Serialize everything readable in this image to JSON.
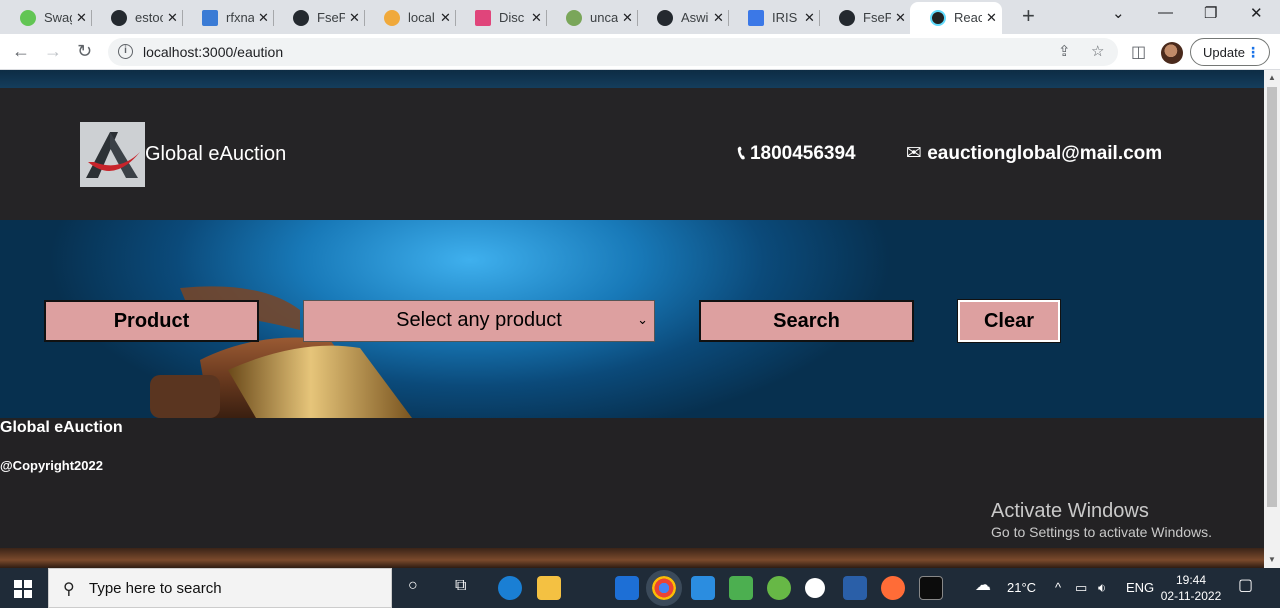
{
  "browser": {
    "tabs": [
      {
        "title": "Swag",
        "color": "#62c554"
      },
      {
        "title": "estoc",
        "color": "#24292f"
      },
      {
        "title": "rfxna",
        "color": "#3a7bd5"
      },
      {
        "title": "FseP",
        "color": "#24292f"
      },
      {
        "title": "local",
        "color": "#f0a93b"
      },
      {
        "title": "Disc",
        "color": "#e0457b"
      },
      {
        "title": "unca",
        "color": "#7aa65a"
      },
      {
        "title": "Aswi",
        "color": "#24292f"
      },
      {
        "title": "IRIS",
        "color": "#3b78e7"
      },
      {
        "title": "FseP",
        "color": "#24292f"
      },
      {
        "title": "Reac",
        "color": "#222222"
      }
    ],
    "new_tab_label": "+",
    "url": "localhost:3000/eaution",
    "update_label": "Update"
  },
  "header": {
    "brand": "Global eAuction",
    "phone": "1800456394",
    "email": "eauctionglobal@mail.com"
  },
  "search_bar": {
    "product_label": "Product",
    "select_value": "Select any product",
    "search_label": "Search",
    "clear_label": "Clear"
  },
  "footer": {
    "title": "Global eAuction",
    "copyright": "@Copyright2022"
  },
  "watermark": {
    "line1": "Activate Windows",
    "line2": "Go to Settings to activate Windows."
  },
  "taskbar": {
    "search_placeholder": "Type here to search",
    "weather": "21°C",
    "language": "ENG",
    "time": "19:44",
    "date": "02-11-2022"
  },
  "colors": {
    "header_bg": "#252426",
    "button_bg": "#dda0a0",
    "hero_blue": "#1879b8"
  }
}
